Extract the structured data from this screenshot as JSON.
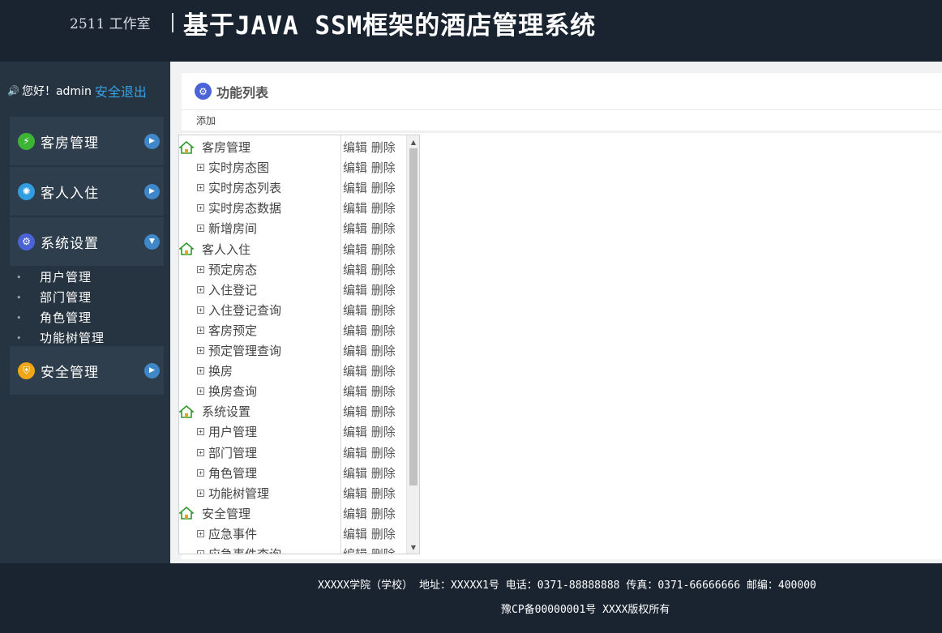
{
  "header": {
    "studio": "2511 工作室",
    "title": "基于JAVA SSM框架的酒店管理系统"
  },
  "sidebar": {
    "greeting": "您好！admin",
    "logout": "安全退出",
    "menus": [
      {
        "label": "客房管理",
        "icon": "lightning-icon",
        "color": "#3cb534"
      },
      {
        "label": "客人入住",
        "icon": "bulb-icon",
        "color": "#2f9de0"
      },
      {
        "label": "系统设置",
        "icon": "gears-icon",
        "color": "#4a63d8",
        "items": [
          "用户管理",
          "部门管理",
          "角色管理",
          "功能树管理"
        ]
      },
      {
        "label": "安全管理",
        "icon": "shield-icon",
        "color": "#f0a617"
      }
    ]
  },
  "panel": {
    "title": "功能列表",
    "add": "添加",
    "edit": "编辑",
    "delete": "删除",
    "tree": [
      {
        "name": "客房管理",
        "level": 1
      },
      {
        "name": "实时房态图",
        "level": 2
      },
      {
        "name": "实时房态列表",
        "level": 2
      },
      {
        "name": "实时房态数据",
        "level": 2
      },
      {
        "name": "新增房间",
        "level": 2
      },
      {
        "name": "客人入住",
        "level": 1
      },
      {
        "name": "预定房态",
        "level": 2
      },
      {
        "name": "入住登记",
        "level": 2
      },
      {
        "name": "入住登记查询",
        "level": 2
      },
      {
        "name": "客房预定",
        "level": 2
      },
      {
        "name": "预定管理查询",
        "level": 2
      },
      {
        "name": "换房",
        "level": 2
      },
      {
        "name": "换房查询",
        "level": 2
      },
      {
        "name": "系统设置",
        "level": 1
      },
      {
        "name": "用户管理",
        "level": 2
      },
      {
        "name": "部门管理",
        "level": 2
      },
      {
        "name": "角色管理",
        "level": 2
      },
      {
        "name": "功能树管理",
        "level": 2
      },
      {
        "name": "安全管理",
        "level": 1
      },
      {
        "name": "应急事件",
        "level": 2
      },
      {
        "name": "应急事件查询",
        "level": 2
      }
    ]
  },
  "footer": {
    "line1": "XXXXX学院（学校） 地址：XXXXX1号 电话：0371-88888888 传真：0371-66666666 邮编：400000",
    "line2": "豫CP备00000001号 XXXX版权所有"
  }
}
